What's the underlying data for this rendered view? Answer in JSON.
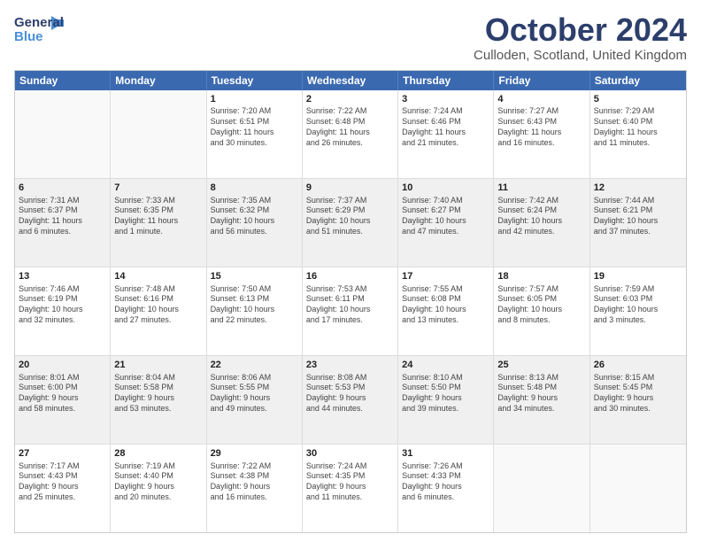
{
  "header": {
    "logo_general": "General",
    "logo_blue": "Blue",
    "title": "October 2024",
    "subtitle": "Culloden, Scotland, United Kingdom"
  },
  "calendar": {
    "days": [
      "Sunday",
      "Monday",
      "Tuesday",
      "Wednesday",
      "Thursday",
      "Friday",
      "Saturday"
    ],
    "rows": [
      [
        {
          "day": "",
          "text": ""
        },
        {
          "day": "",
          "text": ""
        },
        {
          "day": "1",
          "text": "Sunrise: 7:20 AM\nSunset: 6:51 PM\nDaylight: 11 hours\nand 30 minutes."
        },
        {
          "day": "2",
          "text": "Sunrise: 7:22 AM\nSunset: 6:48 PM\nDaylight: 11 hours\nand 26 minutes."
        },
        {
          "day": "3",
          "text": "Sunrise: 7:24 AM\nSunset: 6:46 PM\nDaylight: 11 hours\nand 21 minutes."
        },
        {
          "day": "4",
          "text": "Sunrise: 7:27 AM\nSunset: 6:43 PM\nDaylight: 11 hours\nand 16 minutes."
        },
        {
          "day": "5",
          "text": "Sunrise: 7:29 AM\nSunset: 6:40 PM\nDaylight: 11 hours\nand 11 minutes."
        }
      ],
      [
        {
          "day": "6",
          "text": "Sunrise: 7:31 AM\nSunset: 6:37 PM\nDaylight: 11 hours\nand 6 minutes."
        },
        {
          "day": "7",
          "text": "Sunrise: 7:33 AM\nSunset: 6:35 PM\nDaylight: 11 hours\nand 1 minute."
        },
        {
          "day": "8",
          "text": "Sunrise: 7:35 AM\nSunset: 6:32 PM\nDaylight: 10 hours\nand 56 minutes."
        },
        {
          "day": "9",
          "text": "Sunrise: 7:37 AM\nSunset: 6:29 PM\nDaylight: 10 hours\nand 51 minutes."
        },
        {
          "day": "10",
          "text": "Sunrise: 7:40 AM\nSunset: 6:27 PM\nDaylight: 10 hours\nand 47 minutes."
        },
        {
          "day": "11",
          "text": "Sunrise: 7:42 AM\nSunset: 6:24 PM\nDaylight: 10 hours\nand 42 minutes."
        },
        {
          "day": "12",
          "text": "Sunrise: 7:44 AM\nSunset: 6:21 PM\nDaylight: 10 hours\nand 37 minutes."
        }
      ],
      [
        {
          "day": "13",
          "text": "Sunrise: 7:46 AM\nSunset: 6:19 PM\nDaylight: 10 hours\nand 32 minutes."
        },
        {
          "day": "14",
          "text": "Sunrise: 7:48 AM\nSunset: 6:16 PM\nDaylight: 10 hours\nand 27 minutes."
        },
        {
          "day": "15",
          "text": "Sunrise: 7:50 AM\nSunset: 6:13 PM\nDaylight: 10 hours\nand 22 minutes."
        },
        {
          "day": "16",
          "text": "Sunrise: 7:53 AM\nSunset: 6:11 PM\nDaylight: 10 hours\nand 17 minutes."
        },
        {
          "day": "17",
          "text": "Sunrise: 7:55 AM\nSunset: 6:08 PM\nDaylight: 10 hours\nand 13 minutes."
        },
        {
          "day": "18",
          "text": "Sunrise: 7:57 AM\nSunset: 6:05 PM\nDaylight: 10 hours\nand 8 minutes."
        },
        {
          "day": "19",
          "text": "Sunrise: 7:59 AM\nSunset: 6:03 PM\nDaylight: 10 hours\nand 3 minutes."
        }
      ],
      [
        {
          "day": "20",
          "text": "Sunrise: 8:01 AM\nSunset: 6:00 PM\nDaylight: 9 hours\nand 58 minutes."
        },
        {
          "day": "21",
          "text": "Sunrise: 8:04 AM\nSunset: 5:58 PM\nDaylight: 9 hours\nand 53 minutes."
        },
        {
          "day": "22",
          "text": "Sunrise: 8:06 AM\nSunset: 5:55 PM\nDaylight: 9 hours\nand 49 minutes."
        },
        {
          "day": "23",
          "text": "Sunrise: 8:08 AM\nSunset: 5:53 PM\nDaylight: 9 hours\nand 44 minutes."
        },
        {
          "day": "24",
          "text": "Sunrise: 8:10 AM\nSunset: 5:50 PM\nDaylight: 9 hours\nand 39 minutes."
        },
        {
          "day": "25",
          "text": "Sunrise: 8:13 AM\nSunset: 5:48 PM\nDaylight: 9 hours\nand 34 minutes."
        },
        {
          "day": "26",
          "text": "Sunrise: 8:15 AM\nSunset: 5:45 PM\nDaylight: 9 hours\nand 30 minutes."
        }
      ],
      [
        {
          "day": "27",
          "text": "Sunrise: 7:17 AM\nSunset: 4:43 PM\nDaylight: 9 hours\nand 25 minutes."
        },
        {
          "day": "28",
          "text": "Sunrise: 7:19 AM\nSunset: 4:40 PM\nDaylight: 9 hours\nand 20 minutes."
        },
        {
          "day": "29",
          "text": "Sunrise: 7:22 AM\nSunset: 4:38 PM\nDaylight: 9 hours\nand 16 minutes."
        },
        {
          "day": "30",
          "text": "Sunrise: 7:24 AM\nSunset: 4:35 PM\nDaylight: 9 hours\nand 11 minutes."
        },
        {
          "day": "31",
          "text": "Sunrise: 7:26 AM\nSunset: 4:33 PM\nDaylight: 9 hours\nand 6 minutes."
        },
        {
          "day": "",
          "text": ""
        },
        {
          "day": "",
          "text": ""
        }
      ]
    ]
  }
}
